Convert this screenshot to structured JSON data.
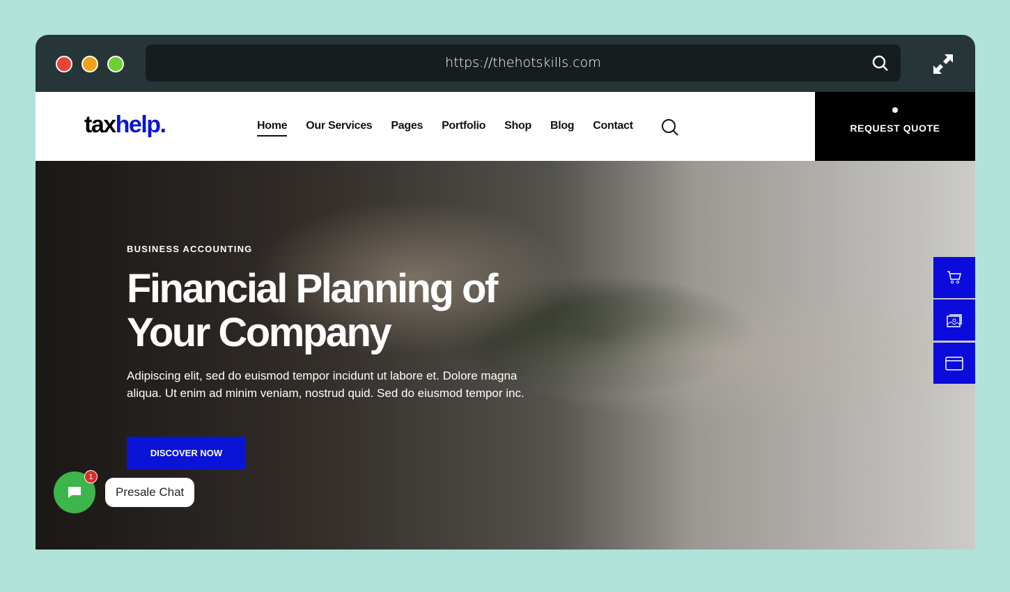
{
  "browser": {
    "url": "https://thehotskills.com",
    "dots": [
      "#ea4335",
      "#f5a01a",
      "#6cd130"
    ]
  },
  "header": {
    "logo_a": "tax",
    "logo_b": "help.",
    "menu": [
      "Home",
      "Our Services",
      "Pages",
      "Portfolio",
      "Shop",
      "Blog",
      "Contact"
    ],
    "active": "Home",
    "quote_label": "REQUEST QUOTE"
  },
  "hero": {
    "kicker": "BUSINESS ACCOUNTING",
    "title": "Financial Planning of Your Company",
    "text": "Adipiscing elit, sed do euismod tempor incidunt ut labore et. Dolore magna aliqua. Ut enim ad minim veniam, nostrud quid. Sed do eiusmod tempor inc.",
    "cta": "DISCOVER NOW"
  },
  "side_buttons": [
    "cart-icon",
    "gallery-icon",
    "browser-window-icon"
  ],
  "chat": {
    "label": "Presale Chat",
    "badge": "1"
  },
  "colors": {
    "accent": "#0b14d6",
    "chat": "#3cb54a"
  }
}
